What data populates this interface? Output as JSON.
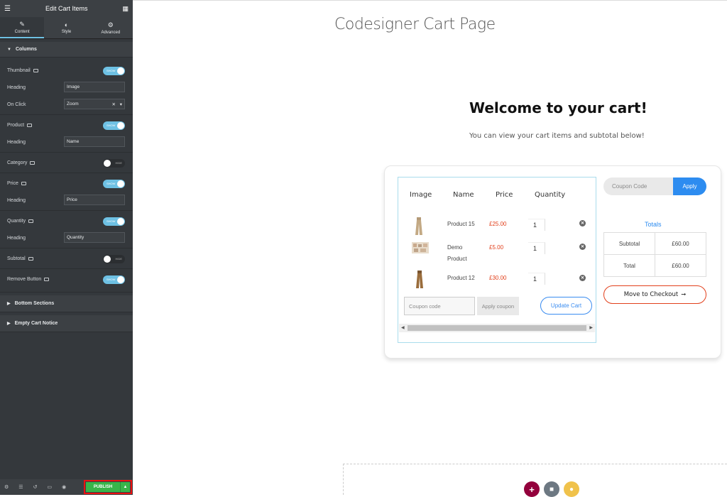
{
  "panel": {
    "title": "Edit Cart Items",
    "tabs": [
      {
        "label": "Content",
        "icon": "pencil-icon"
      },
      {
        "label": "Style",
        "icon": "half-circle-icon"
      },
      {
        "label": "Advanced",
        "icon": "gear-icon"
      }
    ],
    "columns_section": "Columns",
    "thumbnail_label": "Thumbnail",
    "thumbnail_heading_label": "Heading",
    "thumbnail_heading_value": "Image",
    "on_click_label": "On Click",
    "on_click_value": "Zoom",
    "product_label": "Product",
    "product_heading_label": "Heading",
    "product_heading_value": "Name",
    "category_label": "Category",
    "price_label": "Price",
    "price_heading_label": "Heading",
    "price_heading_value": "Price",
    "quantity_label": "Quantity",
    "quantity_heading_label": "Heading",
    "quantity_heading_value": "Quantity",
    "subtotal_label": "Subtotal",
    "remove_button_label": "Remove Button",
    "toggle_show": "SHOW",
    "toggle_hide": "HIDE",
    "bottom_sections": "Bottom Sections",
    "empty_cart_notice": "Empty Cart Notice",
    "publish": "PUBLISH"
  },
  "page": {
    "title": "Codesigner Cart Page",
    "welcome": "Welcome to your cart!",
    "subtitle": "You can view your cart items and subtotal below!",
    "columns": [
      "Image",
      "Name",
      "Price",
      "Quantity"
    ],
    "items": [
      {
        "name": "Product 15",
        "price": "£25.00",
        "qty": "1"
      },
      {
        "name": "Demo Product",
        "price": "£5.00",
        "qty": "1"
      },
      {
        "name": "Product 12",
        "price": "£30.00",
        "qty": "1"
      }
    ],
    "coupon_placeholder": "Coupon code",
    "apply_coupon": "Apply coupon",
    "update_cart": "Update Cart",
    "coupon_code_placeholder": "Coupon Code",
    "apply": "Apply",
    "totals_title": "Totals",
    "subtotal_label": "Subtotal",
    "subtotal_value": "£60.00",
    "total_label": "Total",
    "total_value": "£60.00",
    "checkout": "Move to Checkout",
    "accent": "#2d8cf0",
    "price_color": "#e2401c",
    "publish_color": "#39b54a"
  }
}
